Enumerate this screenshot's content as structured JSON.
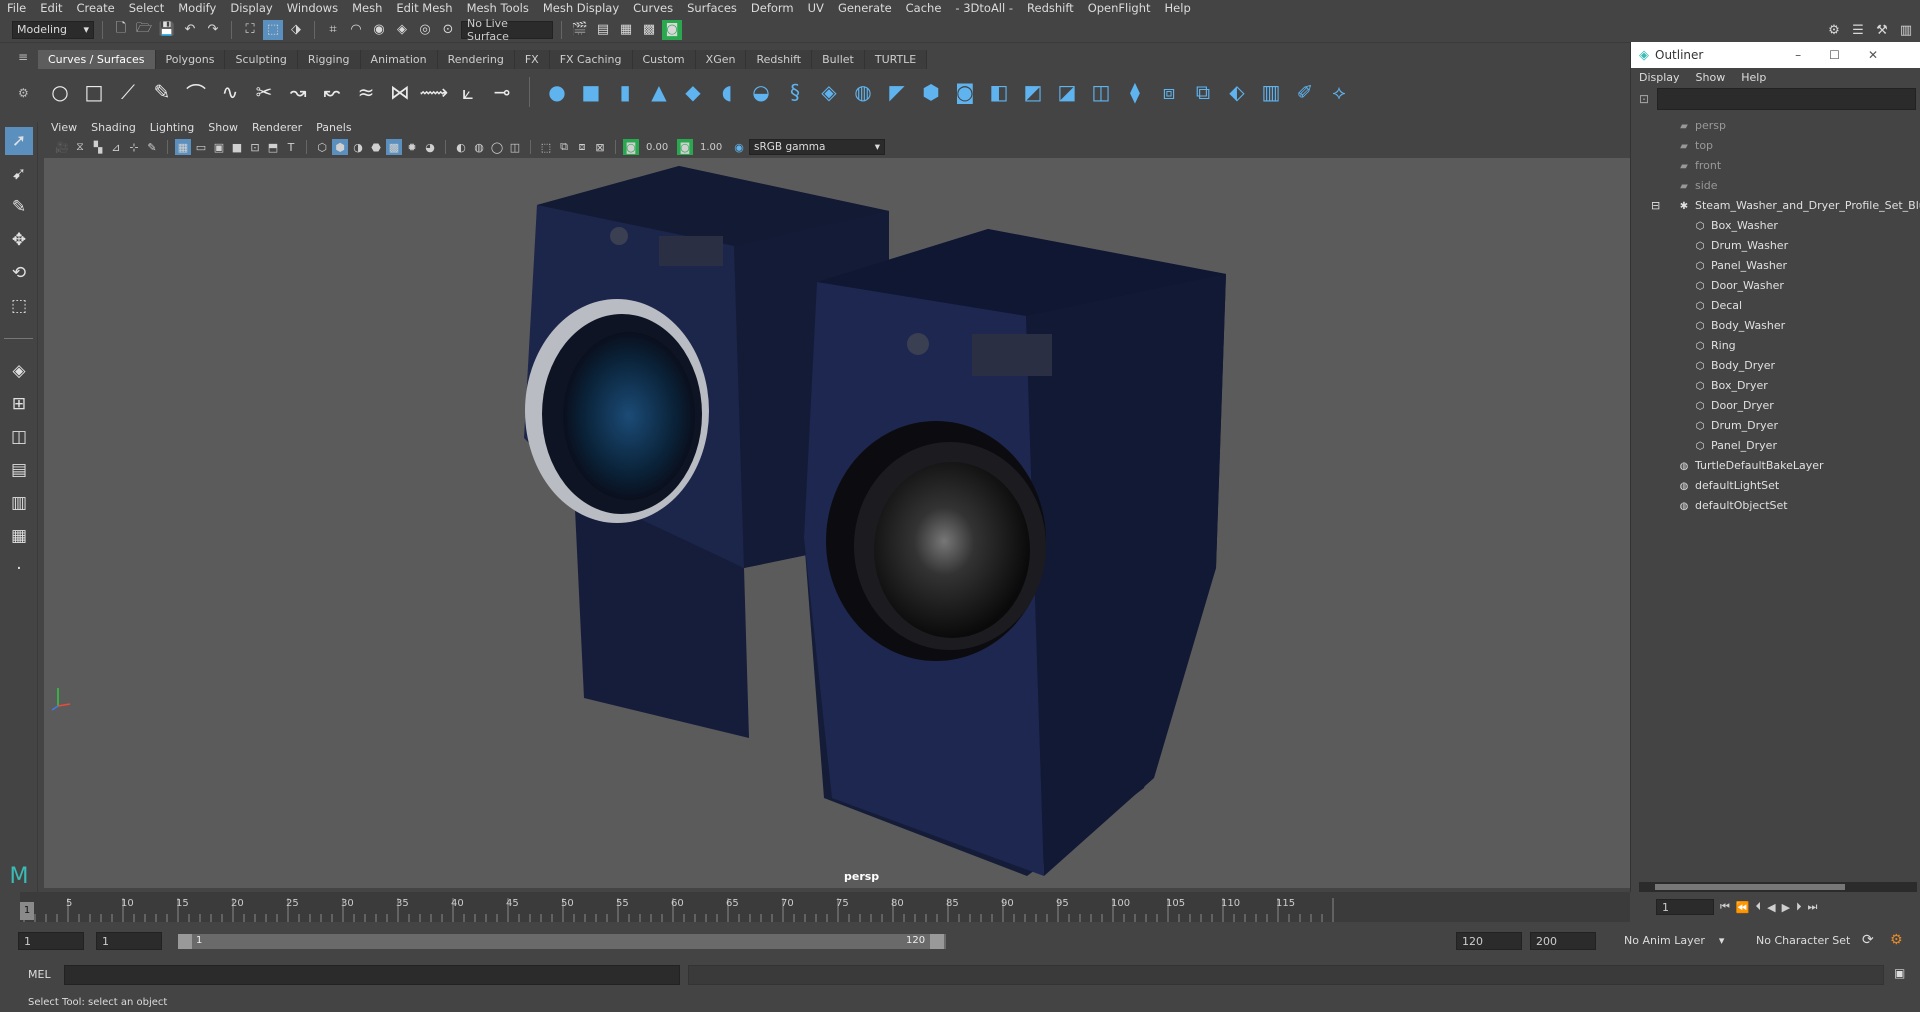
{
  "menubar": [
    "File",
    "Edit",
    "Create",
    "Select",
    "Modify",
    "Display",
    "Windows",
    "Mesh",
    "Edit Mesh",
    "Mesh Tools",
    "Mesh Display",
    "Curves",
    "Surfaces",
    "Deform",
    "UV",
    "Generate",
    "Cache",
    "- 3DtoAll -",
    "Redshift",
    "OpenFlight",
    "Help"
  ],
  "statusline": {
    "workspace": "Modeling",
    "live_surface": "No Live Surface"
  },
  "shelf_tabs": [
    "Curves / Surfaces",
    "Polygons",
    "Sculpting",
    "Rigging",
    "Animation",
    "Rendering",
    "FX",
    "FX Caching",
    "Custom",
    "XGen",
    "Redshift",
    "Bullet",
    "TURTLE"
  ],
  "viewport": {
    "menu": [
      "View",
      "Shading",
      "Lighting",
      "Show",
      "Renderer",
      "Panels"
    ],
    "exposure": "0.00",
    "gamma": "1.00",
    "colorspace": "sRGB gamma",
    "camera_label": "persp"
  },
  "outliner": {
    "title": "Outliner",
    "menu": [
      "Display",
      "Show",
      "Help"
    ],
    "cameras": [
      "persp",
      "top",
      "front",
      "side"
    ],
    "group": "Steam_Washer_and_Dryer_Profile_Set_Blue_",
    "children": [
      "Box_Washer",
      "Drum_Washer",
      "Panel_Washer",
      "Door_Washer",
      "Decal",
      "Body_Washer",
      "Ring",
      "Body_Dryer",
      "Box_Dryer",
      "Door_Dryer",
      "Drum_Dryer",
      "Panel_Dryer"
    ],
    "sets": [
      "TurtleDefaultBakeLayer",
      "defaultLightSet",
      "defaultObjectSet"
    ]
  },
  "timeline": {
    "ticks": [
      "5",
      "10",
      "15",
      "20",
      "25",
      "30",
      "35",
      "40",
      "45",
      "50",
      "55",
      "60",
      "65",
      "70",
      "75",
      "80",
      "85",
      "90",
      "95",
      "100",
      "105",
      "110",
      "115"
    ],
    "start_marker": "1",
    "current_frame": "1"
  },
  "range": {
    "start": "1",
    "start_inner": "1",
    "slider_start": "1",
    "slider_end": "120",
    "end_inner": "120",
    "end": "200",
    "anim_layer": "No Anim Layer",
    "char_set": "No Character Set"
  },
  "cmd": {
    "label": "MEL"
  },
  "help_line": "Select Tool: select an object"
}
